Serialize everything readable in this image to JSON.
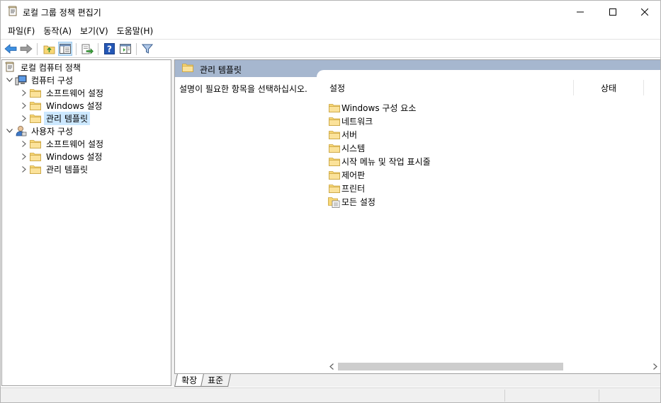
{
  "window": {
    "title": "로컬 그룹 정책 편집기",
    "icon": "policy-scroll-icon"
  },
  "menu": [
    {
      "label": "파일(F)"
    },
    {
      "label": "동작(A)"
    },
    {
      "label": "보기(V)"
    },
    {
      "label": "도움말(H)"
    }
  ],
  "toolbar": {
    "icons": [
      "back-arrow-icon",
      "forward-arrow-icon",
      "up-folder-icon",
      "show-hide-tree-icon",
      "export-list-icon",
      "help-icon",
      "show-hide-action-pane-icon",
      "filter-icon"
    ]
  },
  "tree": {
    "root": "로컬 컴퓨터 정책",
    "computer": {
      "label": "컴퓨터 구성",
      "children": [
        "소프트웨어 설정",
        "Windows 설정",
        "관리 템플릿"
      ]
    },
    "user": {
      "label": "사용자 구성",
      "children": [
        "소프트웨어 설정",
        "Windows 설정",
        "관리 템플릿"
      ]
    }
  },
  "right": {
    "header_title": "관리 템플릿",
    "description": "설명이 필요한 항목을 선택하십시오.",
    "columns": {
      "setting": "설정",
      "state": "상태"
    },
    "items": [
      {
        "label": "Windows 구성 요소",
        "icon": "folder-icon"
      },
      {
        "label": "네트워크",
        "icon": "folder-icon"
      },
      {
        "label": "서버",
        "icon": "folder-icon"
      },
      {
        "label": "시스템",
        "icon": "folder-icon"
      },
      {
        "label": "시작 메뉴 및 작업 표시줄",
        "icon": "folder-icon"
      },
      {
        "label": "제어판",
        "icon": "folder-icon"
      },
      {
        "label": "프린터",
        "icon": "folder-icon"
      },
      {
        "label": "모든 설정",
        "icon": "all-settings-icon"
      }
    ]
  },
  "tabs": {
    "extended": "확장",
    "standard": "표준"
  },
  "colors": {
    "header_bg": "#a6b7cf",
    "selected_bg": "#cce8ff",
    "folder": "#f8d775"
  }
}
